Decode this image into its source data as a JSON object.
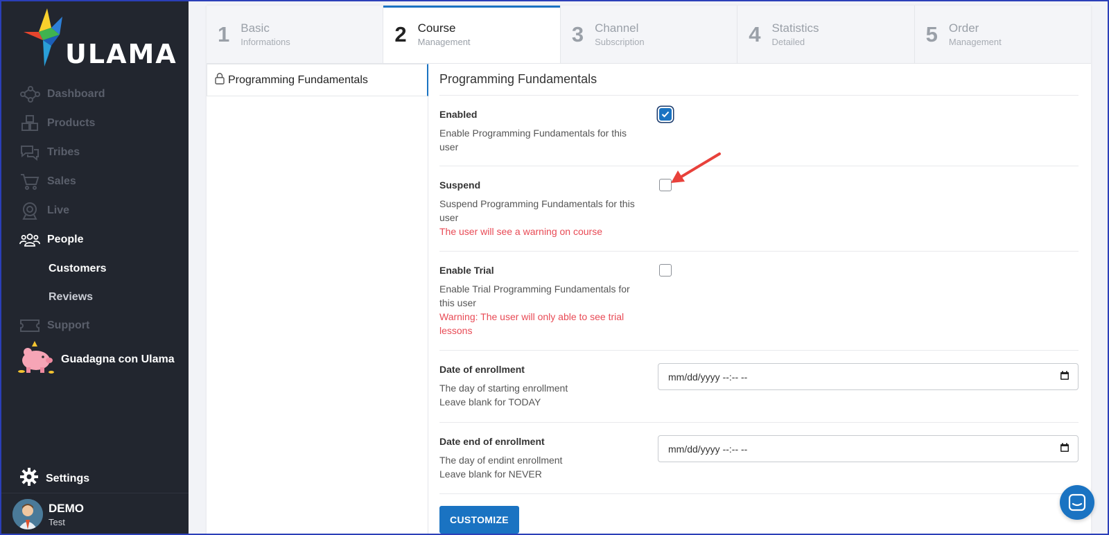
{
  "brand": {
    "logo_text": "ULAMA"
  },
  "sidebar": {
    "items": [
      {
        "label": "Dashboard",
        "icon": "dashboard-icon"
      },
      {
        "label": "Products",
        "icon": "products-icon"
      },
      {
        "label": "Tribes",
        "icon": "tribes-icon"
      },
      {
        "label": "Sales",
        "icon": "cart-icon"
      },
      {
        "label": "Live",
        "icon": "webcam-icon"
      },
      {
        "label": "People",
        "icon": "people-icon",
        "active": true
      },
      {
        "label": "Support",
        "icon": "ticket-icon"
      }
    ],
    "sub_items": [
      {
        "label": "Customers",
        "active": true
      },
      {
        "label": "Reviews"
      }
    ],
    "promo": {
      "label": "Guadagna con Ulama",
      "icon": "piggy-bank-icon"
    },
    "settings": {
      "label": "Settings",
      "icon": "gear-icon"
    },
    "user": {
      "name": "DEMO",
      "subtitle": "Test"
    }
  },
  "steps": [
    {
      "number": "1",
      "title": "Basic",
      "subtitle": "Informations"
    },
    {
      "number": "2",
      "title": "Course",
      "subtitle": "Management",
      "active": true
    },
    {
      "number": "3",
      "title": "Channel",
      "subtitle": "Subscription"
    },
    {
      "number": "4",
      "title": "Statistics",
      "subtitle": "Detailed"
    },
    {
      "number": "5",
      "title": "Order",
      "subtitle": "Management"
    }
  ],
  "course_list": [
    {
      "label": "Programming Fundamentals",
      "icon": "lock-icon"
    }
  ],
  "form": {
    "title": "Programming Fundamentals",
    "enabled": {
      "label": "Enabled",
      "desc_1": "Enable Programming Fundamentals for this",
      "desc_2": "user",
      "checked": true
    },
    "suspend": {
      "label": "Suspend",
      "desc_1": "Suspend Programming Fundamentals for this",
      "desc_2": "user",
      "warning": "The user will see a warning on course",
      "checked": false
    },
    "trial": {
      "label": "Enable Trial",
      "desc_1": "Enable Trial Programming Fundamentals for",
      "desc_2": "this user",
      "warning_1": "Warning: The user will only able to see trial",
      "warning_2": "lessons",
      "checked": false
    },
    "date_start": {
      "label": "Date of enrollment",
      "desc_1": "The day of starting enrollment",
      "desc_2": "Leave blank for TODAY",
      "value": "mm/dd/yyyy --:-- --"
    },
    "date_end": {
      "label": "Date end of enrollment",
      "desc_1": "The day of endint enrollment",
      "desc_2": "Leave blank for NEVER",
      "value": "mm/dd/yyyy --:-- --"
    },
    "customize_label": "CUSTOMIZE"
  },
  "colors": {
    "accent": "#1a73c2",
    "sidebar_bg": "#22262f",
    "warning": "#e84a55",
    "annotation_arrow": "#e8413b"
  }
}
